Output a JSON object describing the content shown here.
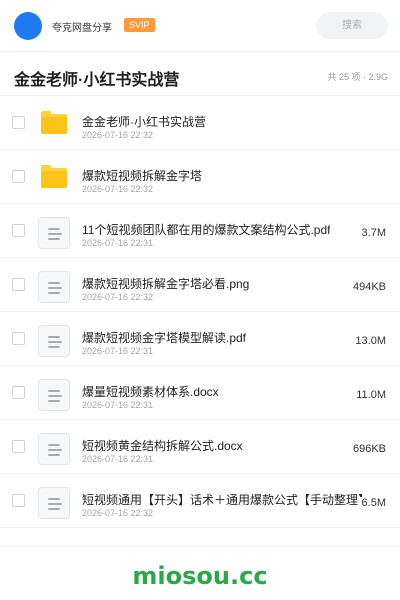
{
  "header": {
    "app_name": "夸克网盘分享",
    "badge": "SVIP",
    "search_placeholder": "搜索"
  },
  "folder": {
    "title": "金金老师·小红书实战营",
    "meta": "共 25 项 · 2.9G"
  },
  "files": [
    {
      "icon": "folder-icon",
      "name": "金金老师·小红书实战营",
      "date": "2026-07-16 22:32",
      "size": ""
    },
    {
      "icon": "folder-icon",
      "name": "爆款短视频拆解金字塔",
      "date": "2026-07-16 22:32",
      "size": ""
    },
    {
      "icon": "document-icon",
      "name": "11个短视频团队都在用的爆款文案结构公式.pdf",
      "date": "2026-07-16 22:31",
      "size": "3.7M"
    },
    {
      "icon": "document-icon",
      "name": "爆款短视频拆解金字塔必看.png",
      "date": "2026-07-16 22:32",
      "size": "494KB"
    },
    {
      "icon": "document-icon",
      "name": "爆款短视频金字塔模型解读.pdf",
      "date": "2026-07-16 22:31",
      "size": "13.0M"
    },
    {
      "icon": "document-icon",
      "name": "爆量短视频素材体系.docx",
      "date": "2026-07-16 22:31",
      "size": "11.0M"
    },
    {
      "icon": "document-icon",
      "name": "短视频黄金结构拆解公式.docx",
      "date": "2026-07-16 22:31",
      "size": "696KB"
    },
    {
      "icon": "document-icon",
      "name": "短视频通用【开头】话术＋通用爆款公式【手动整理】：",
      "date": "2026-07-16 22:32",
      "size": "6.5M"
    }
  ],
  "watermark": "miosou.cc",
  "colors": {
    "avatar": "#1f7bf5",
    "badge": "#ff9a3c",
    "folder": "#fdd23a",
    "watermark": "#2aa84a"
  }
}
